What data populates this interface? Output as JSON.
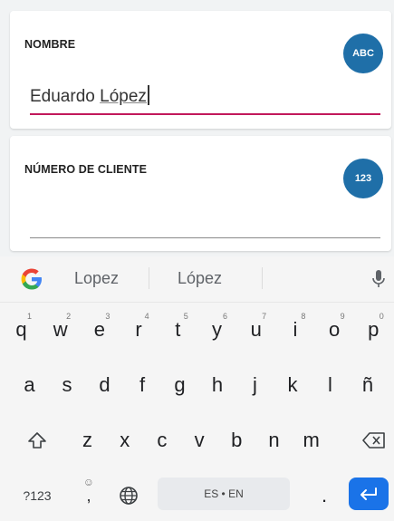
{
  "form": {
    "name_field": {
      "label": "NOMBRE",
      "badge": "ABC",
      "value_plain": "Eduardo ",
      "value_underlined": "López"
    },
    "client_field": {
      "label": "NÚMERO DE CLIENTE",
      "badge": "123",
      "value": ""
    }
  },
  "keyboard": {
    "suggestions": [
      "Lopez",
      "López"
    ],
    "row1": [
      {
        "k": "q",
        "h": "1"
      },
      {
        "k": "w",
        "h": "2"
      },
      {
        "k": "e",
        "h": "3"
      },
      {
        "k": "r",
        "h": "4"
      },
      {
        "k": "t",
        "h": "5"
      },
      {
        "k": "y",
        "h": "6"
      },
      {
        "k": "u",
        "h": "7"
      },
      {
        "k": "i",
        "h": "8"
      },
      {
        "k": "o",
        "h": "9"
      },
      {
        "k": "p",
        "h": "0"
      }
    ],
    "row2": [
      "a",
      "s",
      "d",
      "f",
      "g",
      "h",
      "j",
      "k",
      "l",
      "ñ"
    ],
    "row3": [
      "z",
      "x",
      "c",
      "v",
      "b",
      "n",
      "m"
    ],
    "row4": {
      "symbols": "?123",
      "comma": ",",
      "space_label": "ES • EN",
      "period": "."
    }
  }
}
